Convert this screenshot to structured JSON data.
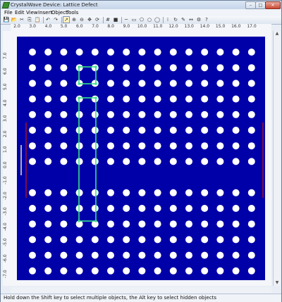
{
  "window": {
    "title": "CrystalWave Device: Lattice Defect",
    "controls": {
      "minimize": "–",
      "maximize": "□",
      "close": "✕"
    }
  },
  "menu": [
    "File",
    "Edit",
    "View",
    "Insert",
    "Object",
    "Tools"
  ],
  "toolbar": {
    "icons": [
      "save-icon",
      "open-icon",
      "cut-icon",
      "copy-icon",
      "paste-icon",
      "undo-icon",
      "redo-icon",
      "pointer-icon",
      "zoom-in-icon",
      "zoom-out-icon",
      "pan-icon",
      "refresh-icon",
      "grid-icon",
      "color-square-icon",
      "line-tool-icon",
      "rectangle-tool-icon",
      "polygon-tool-icon",
      "circle-tool-icon",
      "ellipse-tool-icon",
      "array-tool-icon",
      "rotate-tool-icon",
      "pen-tool-icon",
      "measure-tool-icon",
      "settings-icon",
      "help-icon"
    ],
    "glyphs": [
      "💾",
      "📂",
      "✂",
      "⎘",
      "📋",
      "↶",
      "↷",
      "➚",
      "⊕",
      "⊖",
      "✥",
      "⟳",
      "#",
      "■",
      "─",
      "▭",
      "⬠",
      "○",
      "◯",
      "⁞",
      "↻",
      "✎",
      "↔",
      "⚙",
      "?"
    ]
  },
  "ruler": {
    "x_labels": [
      "2.0",
      "3.0",
      "4.0",
      "5.0",
      "6.0",
      "7.0",
      "8.0",
      "9.0",
      "10.0",
      "11.0",
      "12.0",
      "13.0",
      "14.0",
      "15.0",
      "16.0",
      "17.0"
    ],
    "y_labels": [
      "7.0",
      "6.0",
      "5.0",
      "4.0",
      "3.0",
      "2.0",
      "1.0",
      "0.0",
      "-1.0",
      "-2.0",
      "-3.0",
      "-4.0",
      "-5.0",
      "-6.0",
      "-7.0"
    ]
  },
  "lattice": {
    "columns": 15,
    "rows": 15,
    "missing_row_index": 8,
    "background_color": "#0000a8",
    "hole_color": "#ffffff",
    "selection_color": "#38e08a",
    "source_color": "#9b1030",
    "probe_color": "#e8e8a0"
  },
  "status": {
    "text": "Hold down the Shift key to select multiple objects, the Alt key to select hidden objects"
  }
}
